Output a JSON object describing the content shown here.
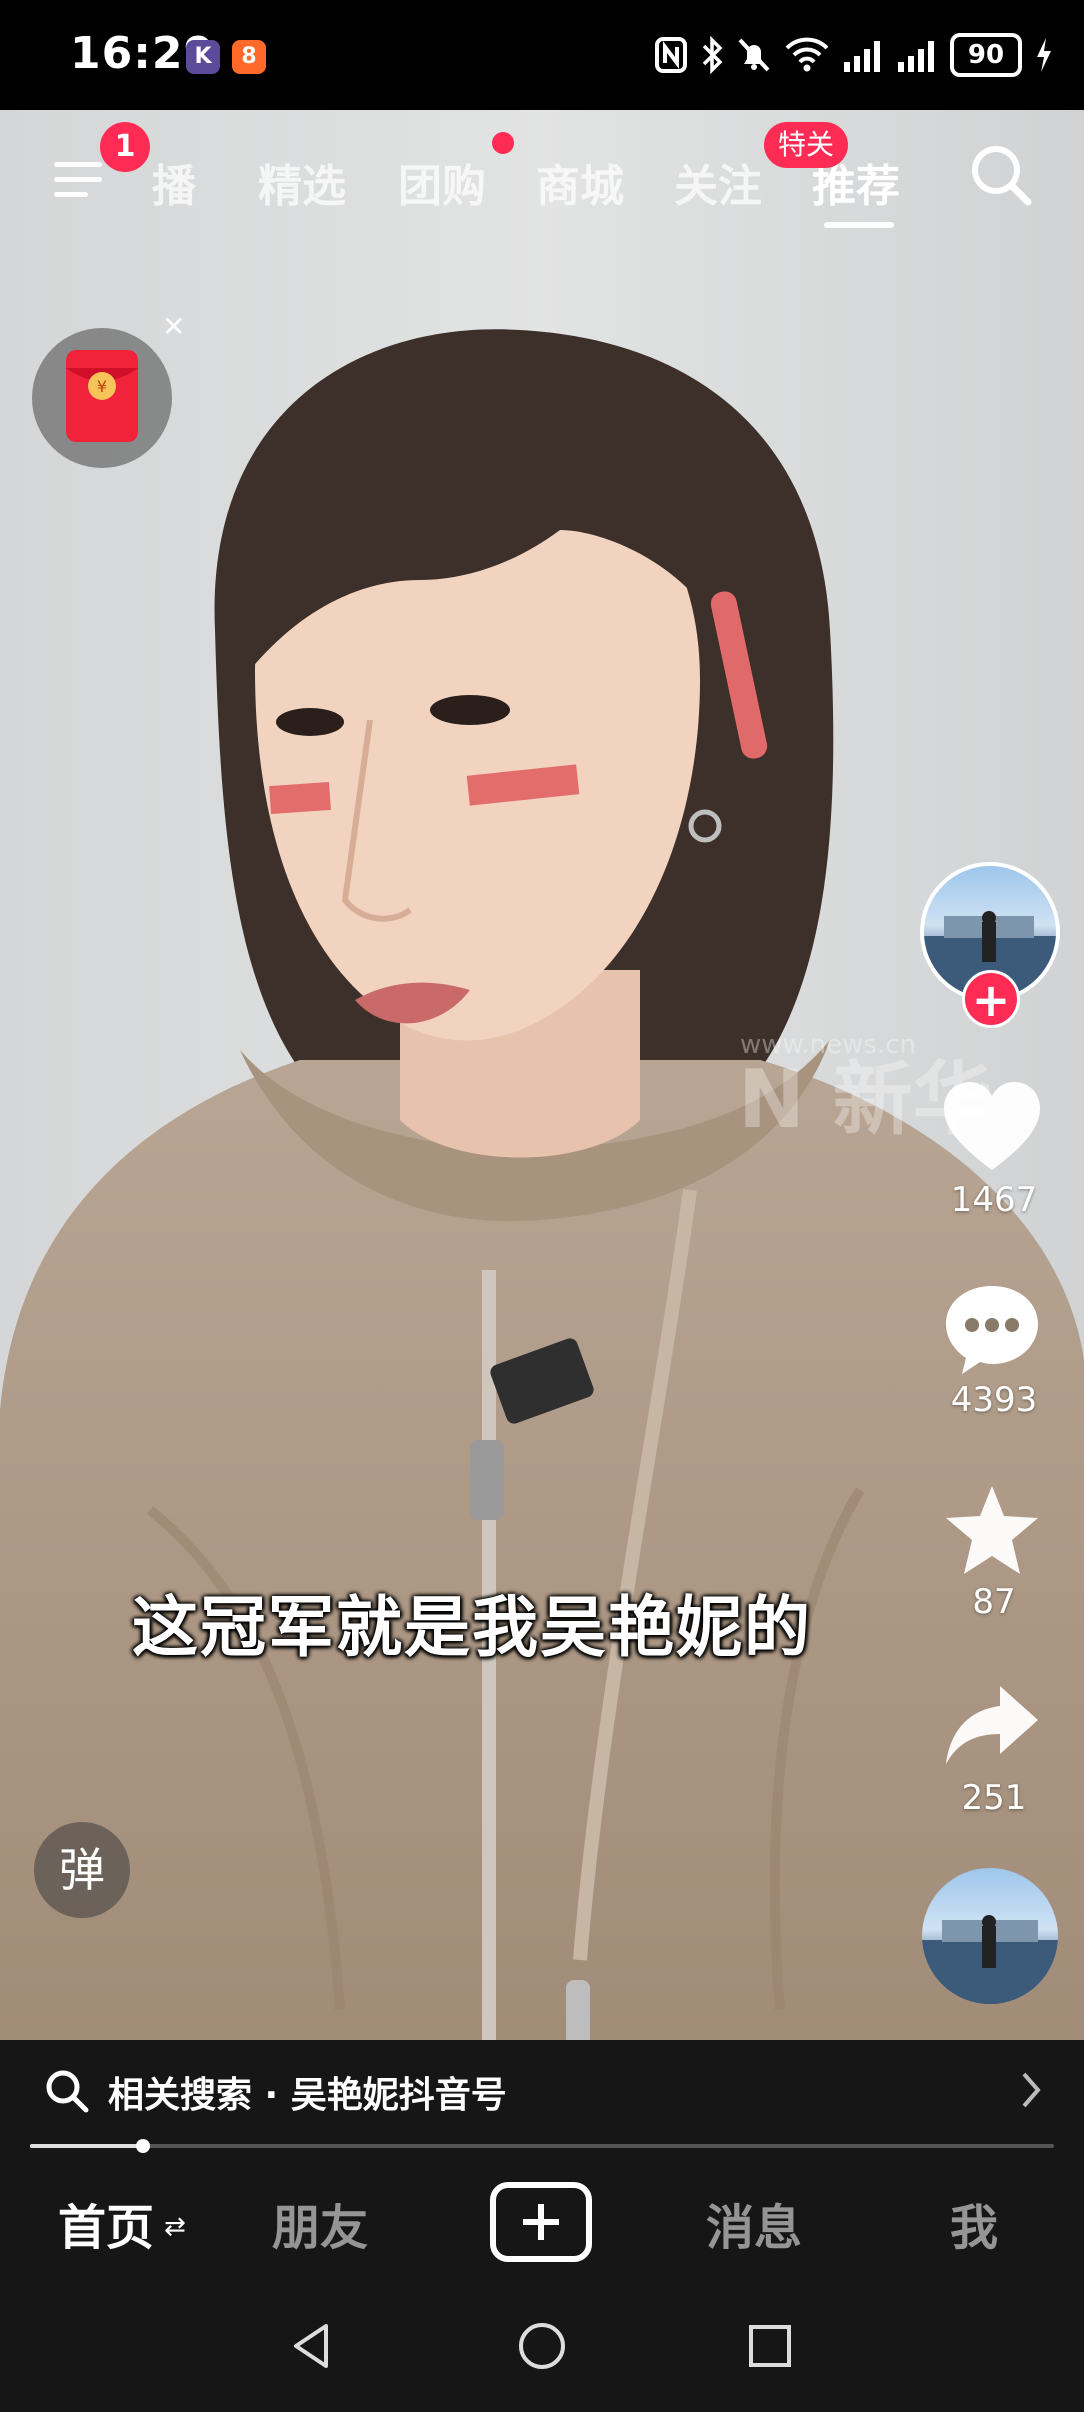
{
  "status_bar": {
    "time": "16:29",
    "app_icons": [
      "K",
      "8"
    ],
    "battery_level": "90"
  },
  "top_nav": {
    "menu_badge": "1",
    "tabs": [
      {
        "label": "播"
      },
      {
        "label": "精选"
      },
      {
        "label": "团购"
      },
      {
        "label": "商城"
      },
      {
        "label": "关注"
      },
      {
        "label": "推荐"
      }
    ],
    "follow_badge": "特关",
    "active_tab": "推荐"
  },
  "video": {
    "subtitle": "这冠军就是我吴艳妮的",
    "danmaku_button": "弹",
    "watermark": "www.news.cn",
    "watermark_brand": "N 新华"
  },
  "actions": {
    "like_count": "1467",
    "comment_count": "4393",
    "favorite_count": "87",
    "share_count": "251"
  },
  "related_search": {
    "text": "相关搜索 · 吴艳妮抖音号"
  },
  "progress": {
    "fraction": 0.11
  },
  "bottom_tabs": {
    "home": "首页",
    "home_swap": "⇄",
    "friends": "朋友",
    "messages": "消息",
    "me": "我"
  },
  "colors": {
    "accent": "#fe2c55",
    "bar_bg": "#161616"
  }
}
